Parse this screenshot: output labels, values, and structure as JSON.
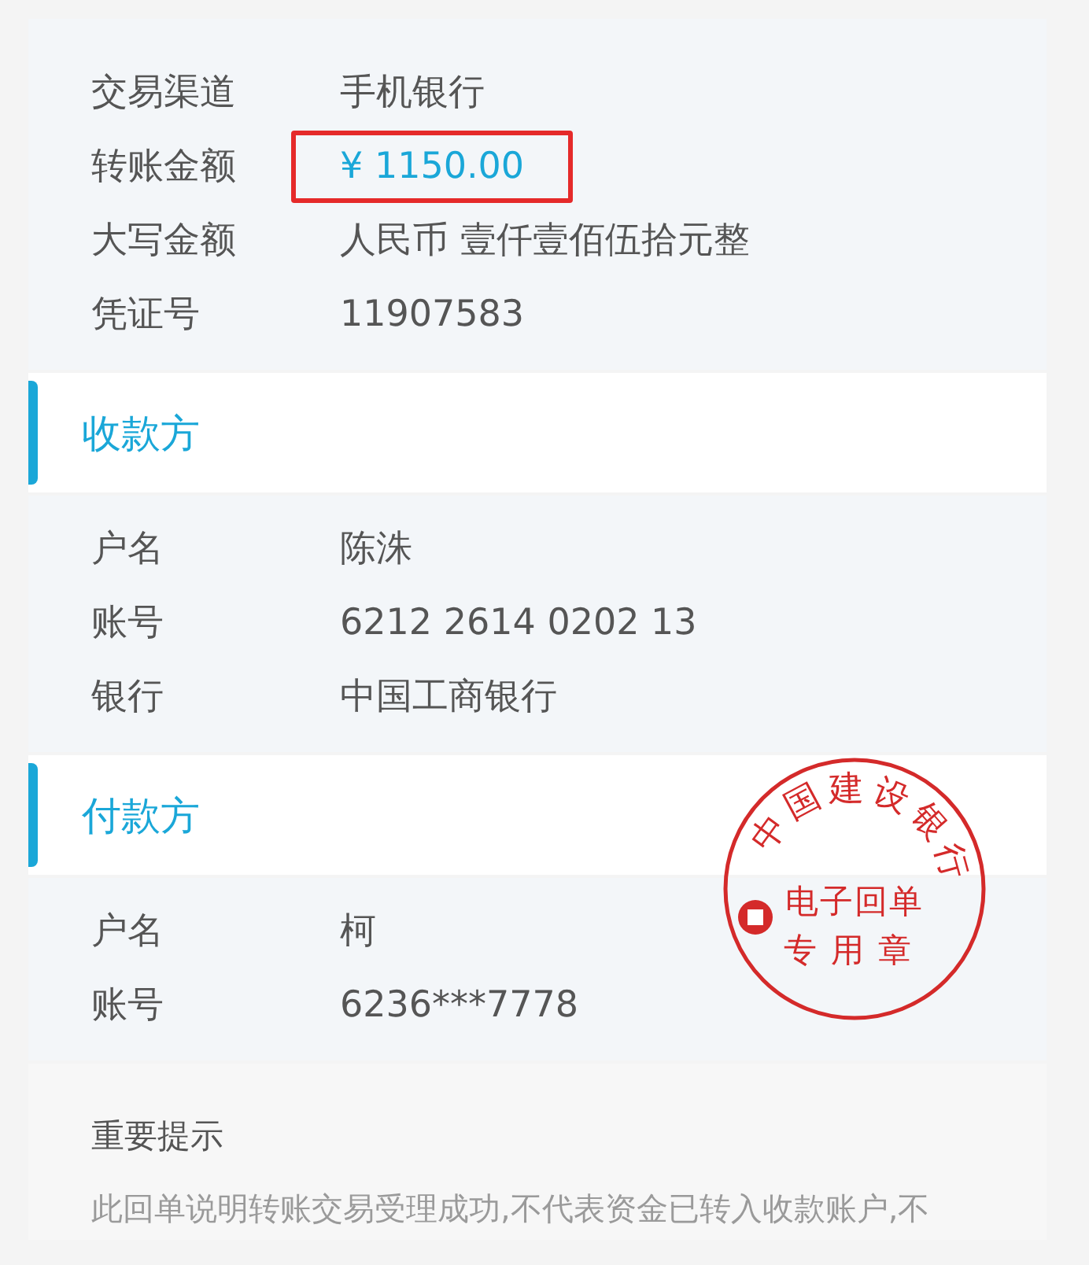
{
  "transaction": {
    "rows": [
      {
        "label": "交易渠道",
        "value": "手机银行",
        "kind": "text"
      },
      {
        "label": "转账金额",
        "value": "¥ 1150.00",
        "kind": "amount"
      },
      {
        "label": "大写金额",
        "value": "人民币 壹仟壹佰伍拾元整",
        "kind": "text"
      },
      {
        "label": "凭证号",
        "value": "11907583",
        "kind": "text"
      }
    ]
  },
  "payee": {
    "title": "收款方",
    "rows": [
      {
        "label": "户名",
        "value": "陈洙"
      },
      {
        "label": "账号",
        "value": "6212 2614 0202 13"
      },
      {
        "label": "银行",
        "value": "中国工商银行"
      }
    ]
  },
  "payer": {
    "title": "付款方",
    "rows": [
      {
        "label": "户名",
        "value": "柯"
      },
      {
        "label": "账号",
        "value": "6236***7778"
      }
    ]
  },
  "stamp": {
    "arc_text": "中国建设银行",
    "lines": [
      "电子回单",
      "专用章"
    ]
  },
  "notice": {
    "title": "重要提示",
    "text": "此回单说明转账交易受理成功,不代表资金已转入收款账户,不"
  }
}
